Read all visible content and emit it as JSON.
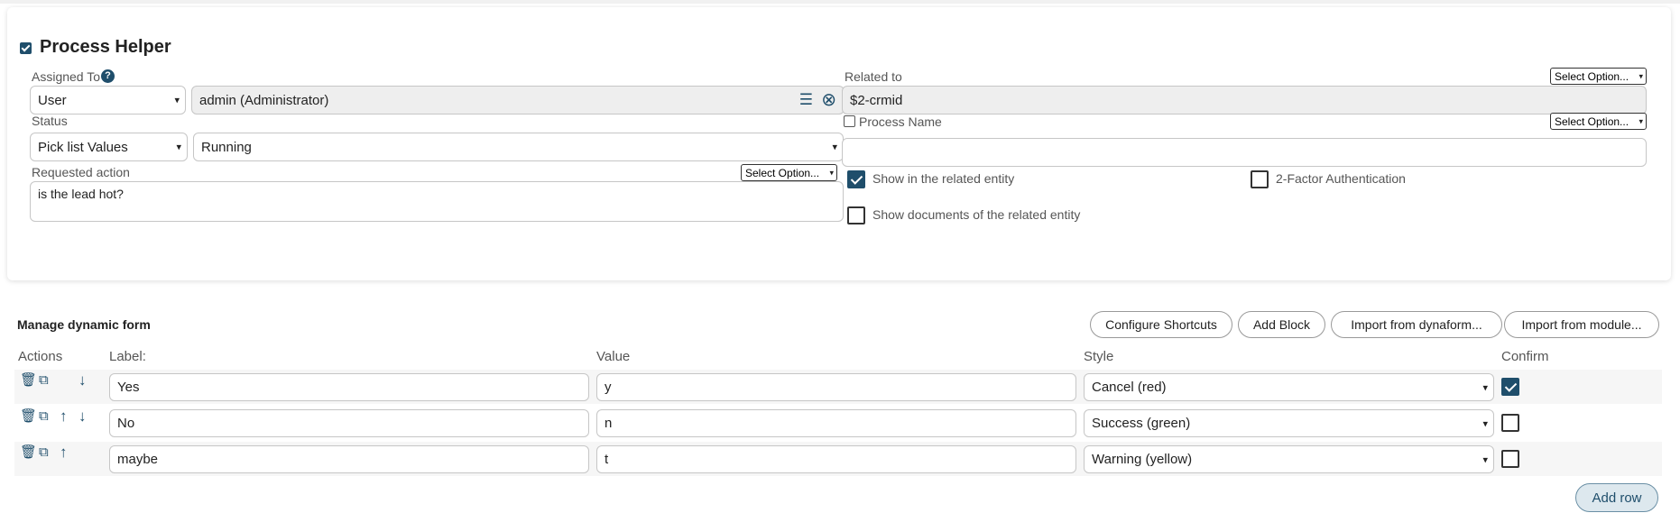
{
  "header": {
    "title": "Process Helper",
    "enabled": true
  },
  "assigned": {
    "label": "Assigned To",
    "type_value": "User",
    "user_value": "admin (Administrator)"
  },
  "related": {
    "label": "Related to",
    "select_option": "Select Option...",
    "value": "$2-crmid"
  },
  "status": {
    "label": "Status",
    "source_value": "Pick list Values",
    "value": "Running"
  },
  "process_name": {
    "label": "Process Name",
    "select_option": "Select Option...",
    "value": ""
  },
  "requested_action": {
    "label": "Requested action",
    "select_option": "Select Option...",
    "value": "is the lead hot?"
  },
  "options": {
    "show_related": "Show in the related entity",
    "show_related_checked": true,
    "two_factor": "2-Factor Authentication",
    "two_factor_checked": false,
    "show_documents": "Show documents of the related entity",
    "show_documents_checked": false
  },
  "dynamic_form": {
    "title": "Manage dynamic form",
    "buttons": {
      "configure_shortcuts": "Configure Shortcuts",
      "add_block": "Add Block",
      "import_dynaform": "Import from dynaform...",
      "import_module": "Import from module..."
    },
    "columns": {
      "actions": "Actions",
      "label": "Label:",
      "value": "Value",
      "style": "Style",
      "confirm": "Confirm"
    },
    "rows": [
      {
        "label": "Yes",
        "value": "y",
        "style": "Cancel (red)",
        "confirm": true
      },
      {
        "label": "No",
        "value": "n",
        "style": "Success (green)",
        "confirm": false
      },
      {
        "label": "maybe",
        "value": "t",
        "style": "Warning (yellow)",
        "confirm": false
      }
    ],
    "add_row": "Add row"
  },
  "icons": {
    "dropdown": "▾",
    "delete": "🗑",
    "copy": "⧉",
    "up": "↑",
    "down": "↓",
    "clear": "⊗",
    "list": "☰",
    "help": "?"
  },
  "colors": {
    "accent": "#1f4e6b"
  }
}
